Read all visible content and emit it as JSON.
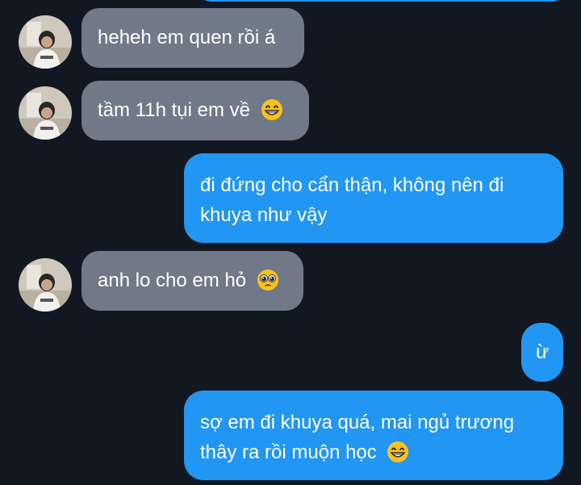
{
  "messages": [
    {
      "id": "m1",
      "side": "incoming",
      "text": "heheh em quen rồi á",
      "emoji": null
    },
    {
      "id": "m2",
      "side": "incoming",
      "text": "tầm 11h tụi em về",
      "emoji": "grinning-face-emoji"
    },
    {
      "id": "m3",
      "side": "outgoing",
      "line1": "đi đứng cho cẩn thận, không nên đi",
      "line2": "khuya như vậy",
      "emoji": null
    },
    {
      "id": "m4",
      "side": "incoming",
      "text": "anh lo cho em hỏ",
      "emoji": "pleading-face-emoji"
    },
    {
      "id": "m5",
      "side": "outgoing",
      "text": "ừ",
      "emoji": null
    },
    {
      "id": "m6",
      "side": "outgoing",
      "line1": "sợ em đi khuya quá, mai ngủ trương",
      "line2": "thây ra rồi muộn học",
      "emoji": "grinning-face-emoji"
    }
  ],
  "colors": {
    "background": "#121821",
    "incoming_bubble": "#707988",
    "outgoing_bubble": "#2196f3",
    "text": "#ffffff"
  }
}
